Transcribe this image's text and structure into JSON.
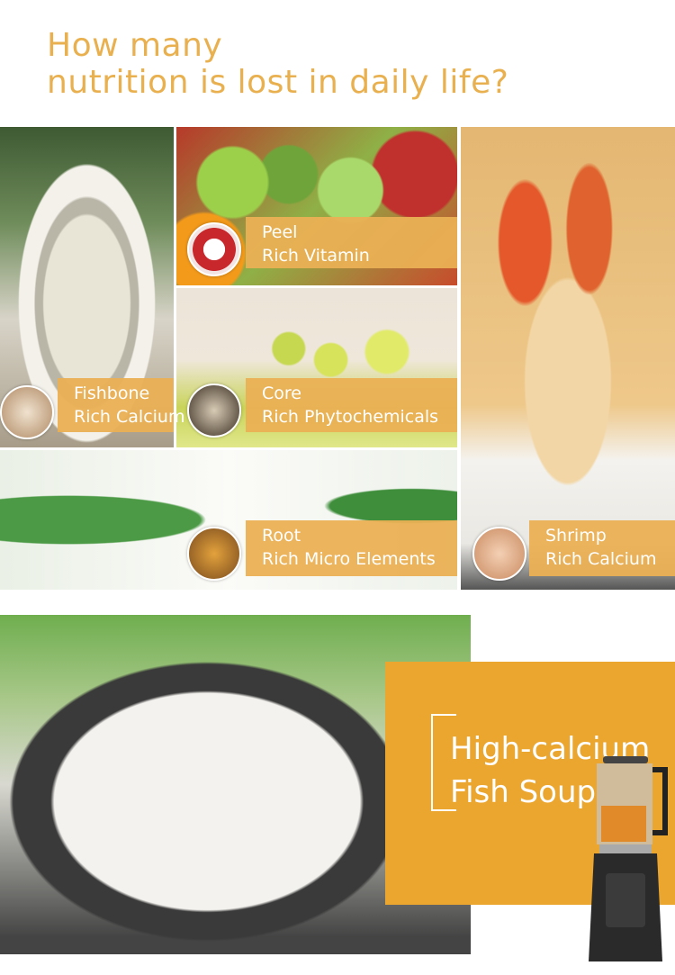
{
  "header": {
    "title_line1": "How many",
    "title_line2": "nutrition is lost in daily life?"
  },
  "tiles": [
    {
      "name": "Fishbone",
      "benefit": "Rich Calcium"
    },
    {
      "name": "Peel",
      "benefit": "Rich Vitamin"
    },
    {
      "name": "Core",
      "benefit": "Rich Phytochemicals"
    },
    {
      "name": "Root",
      "benefit": "Rich Micro Elements"
    },
    {
      "name": "Shrimp",
      "benefit": "Rich Calcium"
    }
  ],
  "feature": {
    "line1": "High-calcium",
    "line2": "Fish Soup"
  },
  "colors": {
    "accent": "#e9b04f",
    "panel": "#eba630",
    "label_bg": "#eab054"
  }
}
